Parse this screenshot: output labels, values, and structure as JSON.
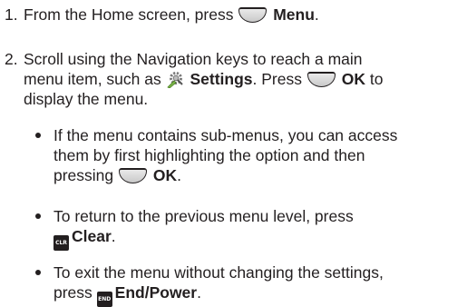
{
  "steps": [
    {
      "number": "1.",
      "line1": {
        "before": "From the Home screen, press",
        "key_label": "Menu",
        "after": "."
      }
    },
    {
      "number": "2.",
      "line1": "Scroll using the Navigation keys to reach a main",
      "line2": {
        "before": "menu item, such as",
        "item_label": "Settings",
        "mid": ". Press",
        "key_label": "OK",
        "after": "to"
      },
      "line3": "display the menu."
    }
  ],
  "bullets": [
    {
      "line1": "If the menu contains sub-menus, you can access",
      "line2": "them by first highlighting the option and then",
      "line3": {
        "before": "pressing",
        "key_label": "OK",
        "after": "."
      }
    },
    {
      "line1": "To return to the previous menu level, press",
      "line2": {
        "icon_text": "CLR",
        "key_label": "Clear",
        "after": "."
      }
    },
    {
      "line1": "To exit the menu without changing the settings,",
      "line2": {
        "before": "press",
        "icon_text": "END",
        "key_label": "End/Power",
        "after": "."
      }
    }
  ],
  "icons": {
    "softkey": "softkey-icon",
    "settings": "settings-icon",
    "clear_key": "clr-key-icon",
    "end_key": "end-power-key-icon"
  },
  "colors": {
    "text": "#231f20",
    "softkey_fill": "#d6d6d6",
    "settings_green": "#7ab648"
  }
}
